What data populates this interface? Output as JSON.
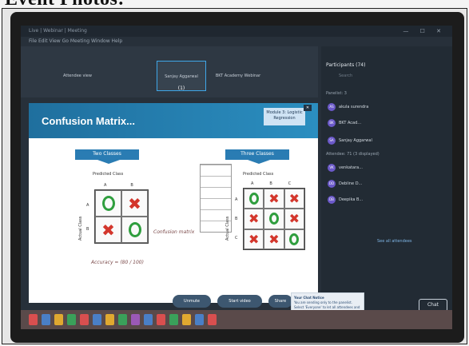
{
  "page": {
    "heading": "Event Photos:"
  },
  "window": {
    "title": "Live | Webinar | Meeting",
    "menu": "File  Edit  View  Go  Meeting  Window  Help",
    "controls": "— ☐ ✕"
  },
  "strip": {
    "tiles": [
      {
        "label": "Attendee view"
      },
      {
        "label": "Sanjay Aggarwal",
        "sub": "(1)"
      },
      {
        "label": "BKT Academy Webinar"
      }
    ]
  },
  "slide": {
    "title": "Confusion Matrix...",
    "tip": "Module 3: Logistic Regression",
    "two_classes": {
      "banner": "Two Classes",
      "predicted": "Predicted Class",
      "actual": "Actual Class",
      "col_labels": [
        "A",
        "B"
      ],
      "row_labels": [
        "A",
        "B"
      ],
      "cells": [
        "circle",
        "cross",
        "cross",
        "circle"
      ]
    },
    "three_classes": {
      "banner": "Three Classes",
      "predicted": "Predicted Class",
      "actual": "Actual Class",
      "col_labels": [
        "A",
        "B",
        "C"
      ],
      "row_labels": [
        "A",
        "B",
        "C"
      ],
      "cells": [
        "circle",
        "cross",
        "cross",
        "cross",
        "circle",
        "cross",
        "cross",
        "cross",
        "circle"
      ]
    },
    "annotations": {
      "sketch1": "Confusion matrix",
      "sketch2": "Accuracy = (80 / 100)"
    }
  },
  "participants": {
    "header": "Participants (74)",
    "search": "Search",
    "panelists_label": "Panelist: 3",
    "panelists": [
      {
        "initials": "AS",
        "name": "akula surendra"
      },
      {
        "initials": "BK",
        "name": "BKT Acad..."
      },
      {
        "initials": "SA",
        "name": "Sanjay Aggarwal"
      }
    ],
    "attendees_label": "Attendee: 71 (3 displayed)",
    "attendees": [
      {
        "initials": "VK",
        "name": "venkatara..."
      },
      {
        "initials": "DD",
        "name": "Debline D..."
      },
      {
        "initials": "DB",
        "name": "Deepika B..."
      }
    ],
    "see_all": "See all attendees"
  },
  "toolbar": {
    "unmute": "Unmute",
    "start_video": "Start video",
    "share": "Share",
    "chat": "Chat"
  },
  "toast": {
    "title": "Your Chat Notice",
    "body": "You are sending only to the panelist. Select 'Everyone' to let all attendees and panelists see your chat."
  },
  "colors": {
    "slide_header": "#2b8ec0",
    "circle": "#2f9e3e",
    "cross": "#d3362c",
    "panel": "#222b34",
    "taskbar": "#5a4a4a"
  }
}
